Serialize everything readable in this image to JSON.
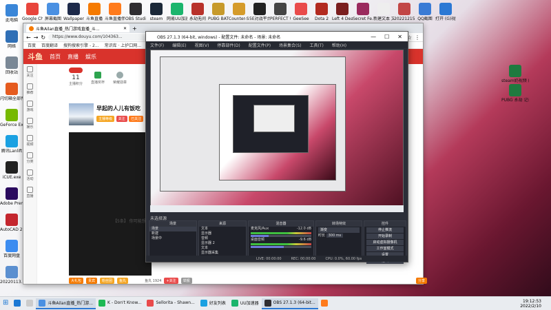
{
  "desktop_icons_left": [
    {
      "label": "此电脑",
      "color": "#3a86d8"
    },
    {
      "label": "网络",
      "color": "#2f6fb6"
    },
    {
      "label": "回收站",
      "color": "#7a8896"
    },
    {
      "label": "闪切箱全部件",
      "color": "#e55b1f"
    },
    {
      "label": "GeForce Experience",
      "color": "#76b900"
    },
    {
      "label": "腾讯Lanlift",
      "color": "#1ba1e2"
    },
    {
      "label": "iCUE.exe",
      "color": "#222222"
    },
    {
      "label": "Adobe Premie...",
      "color": "#2a0a5e"
    },
    {
      "label": "AutoCAD 2021",
      "color": "#c4262e"
    },
    {
      "label": "百度网盘",
      "color": "#3c8cf0"
    },
    {
      "label": "20220113...",
      "color": "#5b8fd0"
    }
  ],
  "desktop_icons_top": [
    {
      "label": "Google Chrome",
      "color": "#e8453c"
    },
    {
      "label": "屏幕截图",
      "color": "#4a90e2"
    },
    {
      "label": "Wallpaper Engine",
      "color": "#1d2a4a"
    },
    {
      "label": "斗鱼直播",
      "color": "#f57a00"
    },
    {
      "label": "斗鱼直播伴侣",
      "color": "#ff7b1c"
    },
    {
      "label": "OBS Studio",
      "color": "#302e31"
    },
    {
      "label": "steam",
      "color": "#1b2838"
    },
    {
      "label": "网易UU加速器",
      "color": "#1bb56d"
    },
    {
      "label": "永劫无间",
      "color": "#b8322b"
    },
    {
      "label": "PUBG BATTLE...",
      "color": "#c79a2b"
    },
    {
      "label": "Counter-Strike...",
      "color": "#d59b2a"
    },
    {
      "label": "5E对战平台",
      "color": "#222222"
    },
    {
      "label": "PERFECT WORLD",
      "color": "#444444"
    },
    {
      "label": "GeeSee",
      "color": "#e94b4b"
    },
    {
      "label": "Dota 2",
      "color": "#b22b20"
    },
    {
      "label": "Left 4 Dead 2",
      "color": "#7a1f1f"
    },
    {
      "label": "Secret Fe...",
      "color": "#9a2b5e"
    },
    {
      "label": "新建文本 文档",
      "color": "#eeeeee"
    },
    {
      "label": "20221215...",
      "color": "#c24646"
    },
    {
      "label": "QQ截图",
      "color": "#3a7bd5"
    },
    {
      "label": "打开 (G)视频 的课程站",
      "color": "#2b78d4"
    }
  ],
  "desktop_icons_right": [
    {
      "label": "steam奶视频 成绩加速器",
      "color": "#1f7a3f"
    },
    {
      "label": "PUBG 永劫 记录时CDK...",
      "color": "#1f7a3f"
    }
  ],
  "browser": {
    "tab_title": "斗鱼Ailan直播_热门游戏直播_斗...",
    "url": "https://www.douyu.com/104363...",
    "bookmarks": [
      "百度",
      "百度翻译",
      "搜狗搜索引擎 - 2...",
      "常识库 · 上护口网..."
    ],
    "nav": [
      "首页",
      "直播",
      "娱乐"
    ],
    "left_nav": [
      "关注",
      "推荐",
      "游戏",
      "娱乐",
      "视频",
      "分类",
      "活动",
      "直播"
    ],
    "stats": [
      {
        "value": "11",
        "label": "主播积分"
      },
      {
        "label": "直播奖杯"
      },
      {
        "label": "荣耀勋章"
      }
    ],
    "room_title": "早起的人儿有饭吃",
    "room_tags": [
      "主播等级",
      "关注",
      "已关注"
    ],
    "follow_btn": "+关注",
    "report_btn": "举报",
    "chat_notice": "【5条】 你可能想看 -KY59",
    "bottom_tags": [
      "大礼包",
      "贵宾",
      "粉丝团",
      "鱼丸"
    ],
    "views": "鱼丸 1924",
    "share": "分享"
  },
  "obs": {
    "title": "OBS 27.1.3 (64-bit, windows) - 配置文件: 未命名 - 场景: 未命名",
    "menu": [
      "文件(F)",
      "编辑(E)",
      "视图(V)",
      "停靠部件(D)",
      "配置文件(P)",
      "场景集合(S)",
      "工具(T)",
      "帮助(H)"
    ],
    "source_label": "未选择源",
    "panels": {
      "scenes": {
        "header": "场景",
        "items": [
          "场景",
          "新建",
          "场景中"
        ]
      },
      "sources": {
        "header": "来源",
        "items": [
          "文本",
          "显示器",
          "音频",
          "显示器 2",
          "文本",
          "显示器采集"
        ]
      },
      "mixer": {
        "header": "混音器",
        "items": [
          "麦克风/Aux",
          "桌面音频"
        ],
        "db": [
          "-12.0 dB",
          "-9.6 dB"
        ]
      },
      "transitions": {
        "header": "转场特效",
        "type": "渐变",
        "duration_label": "时长",
        "duration": "300 ms"
      },
      "controls": {
        "header": "控件",
        "buttons": [
          "停止推流",
          "开始录制",
          "启动虚拟摄像机",
          "工作室模式",
          "设置",
          "退出"
        ]
      }
    },
    "status": [
      "LIVE: 00:00:00",
      "REC: 00:00:00",
      "CPU: 0.0%, 60.00 fps"
    ]
  },
  "taskbar": {
    "items": [
      {
        "label": "",
        "color": "#1b78d4"
      },
      {
        "label": "",
        "color": "#cccccc"
      },
      {
        "label": "斗鱼Ailan直播_热门游...",
        "color": "#4a90e2",
        "active": true
      },
      {
        "label": "K - Don't Know...",
        "color": "#1db954"
      },
      {
        "label": "Sellorita - Shawn...",
        "color": "#e94b4b"
      },
      {
        "label": "好友列表",
        "color": "#1ba1e2"
      },
      {
        "label": "UU加速器",
        "color": "#1bb56d"
      },
      {
        "label": "OBS 27.1.3 (64-bit...",
        "color": "#302e31",
        "active": true
      },
      {
        "label": "",
        "color": "#ff7b1c"
      }
    ],
    "time": "19:12:53",
    "date": "2022/2/10"
  }
}
